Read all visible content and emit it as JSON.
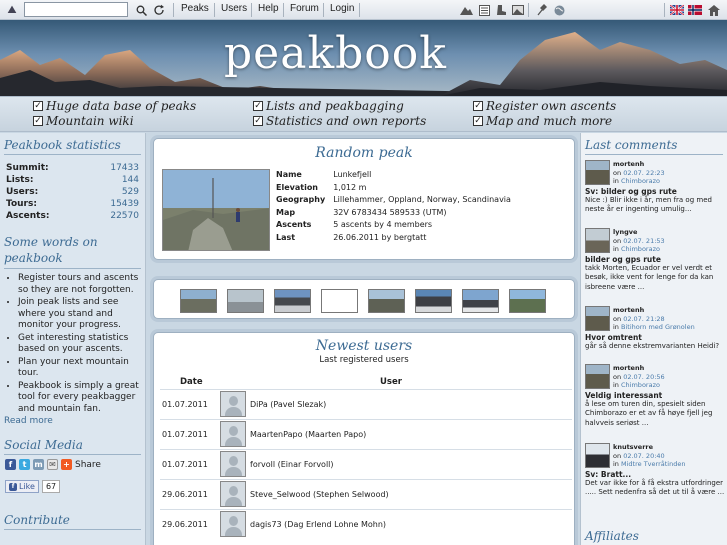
{
  "topbar": {
    "search": {
      "value": "",
      "placeholder": ""
    },
    "nav": [
      "Peaks",
      "Users",
      "Help",
      "Forum",
      "Login"
    ]
  },
  "brand": {
    "name": "peakbook"
  },
  "features": [
    "Huge data base of peaks",
    "Lists and peakbagging",
    "Register own ascents",
    "Mountain wiki",
    "Statistics and own reports",
    "Map and much more"
  ],
  "stats": {
    "title": "Peakbook statistics",
    "rows": [
      {
        "label": "Summit:",
        "value": "17433"
      },
      {
        "label": "Lists:",
        "value": "144"
      },
      {
        "label": "Users:",
        "value": "529"
      },
      {
        "label": "Tours:",
        "value": "15439"
      },
      {
        "label": "Ascents:",
        "value": "22570"
      }
    ]
  },
  "words": {
    "title": "Some words on peakbook",
    "items": [
      "Register tours and ascents so they are not forgotten.",
      "Join peak lists and see where you stand and monitor your progress.",
      "Get interesting statistics based on your ascents.",
      "Plan your next mountain tour.",
      "Peakbook is simply a great tool for every peakbagger and mountain fan."
    ],
    "read_more": "Read more"
  },
  "social": {
    "title": "Social Media",
    "share": "Share",
    "like": "Like",
    "like_count": "67"
  },
  "contribute": {
    "title": "Contribute"
  },
  "random_peak": {
    "title": "Random peak",
    "rows": [
      {
        "key": "Name",
        "value": "Lunkefjell"
      },
      {
        "key": "Elevation",
        "value": "1,012 m"
      },
      {
        "key": "Geography",
        "value": "Lillehammer, Oppland, Norway, Scandinavia"
      },
      {
        "key": "Map",
        "value": "32V 6783434 589533 (UTM)"
      },
      {
        "key": "Ascents",
        "value": "5 ascents by 4 members"
      },
      {
        "key": "Last",
        "value": "26.06.2011 by bergtatt"
      }
    ]
  },
  "newest_users": {
    "title": "Newest users",
    "subtitle": "Last registered users",
    "col_date": "Date",
    "col_user": "User",
    "rows": [
      {
        "date": "01.07.2011",
        "user": "DiPa (Pavel Slezak)"
      },
      {
        "date": "01.07.2011",
        "user": "MaartenPapo (Maarten Papo)"
      },
      {
        "date": "01.07.2011",
        "user": "forvoll (Einar Forvoll)"
      },
      {
        "date": "29.06.2011",
        "user": "Steve_Selwood (Stephen Selwood)"
      },
      {
        "date": "29.06.2011",
        "user": "dagis73 (Dag Erlend Lohne Mohn)"
      }
    ]
  },
  "last_comments": {
    "title": "Last comments",
    "items": [
      {
        "author": "mortenh",
        "on": "on",
        "date": "02.07. 22:23",
        "in": "in",
        "place": "Chimborazo",
        "title": "Sv: bilder og gps rute",
        "text": "Nice :) Blir ikke i år, men fra og med neste år er ingenting umulig..."
      },
      {
        "author": "lyngve",
        "on": "on",
        "date": "02.07. 21:53",
        "in": "in",
        "place": "Chimborazo",
        "title": "bilder og gps rute",
        "text": "takk Morten, Ecuador er vel verdt et besøk, ikke vent for lenge for da kan isbreene være ..."
      },
      {
        "author": "mortenh",
        "on": "on",
        "date": "02.07. 21:28",
        "in": "in",
        "place": "Bitihorn med Grønolen",
        "title": "Hvor omtrent",
        "text": "går så denne ekstremvarianten Heidi?"
      },
      {
        "author": "mortenh",
        "on": "on",
        "date": "02.07. 20:56",
        "in": "in",
        "place": "Chimborazo",
        "title": "Veldig interessant",
        "text": "å lese om turen din, spesielt siden Chimborazo er et av få høye fjell jeg halvveis seriøst ..."
      },
      {
        "author": "knutsverre",
        "on": "on",
        "date": "02.07. 20:40",
        "in": "in",
        "place": "Midtre Tverråtinden",
        "title": "Sv: Bratt...",
        "text": "Det var ikke for å få ekstra utfordringer ..... Sett nedenfra så det ut til å være ..."
      }
    ]
  },
  "affiliates": {
    "title": "Affiliates"
  },
  "colors": {
    "accent": "#3d6b93",
    "link": "#4b7cab",
    "background": "#c9d7e3"
  }
}
